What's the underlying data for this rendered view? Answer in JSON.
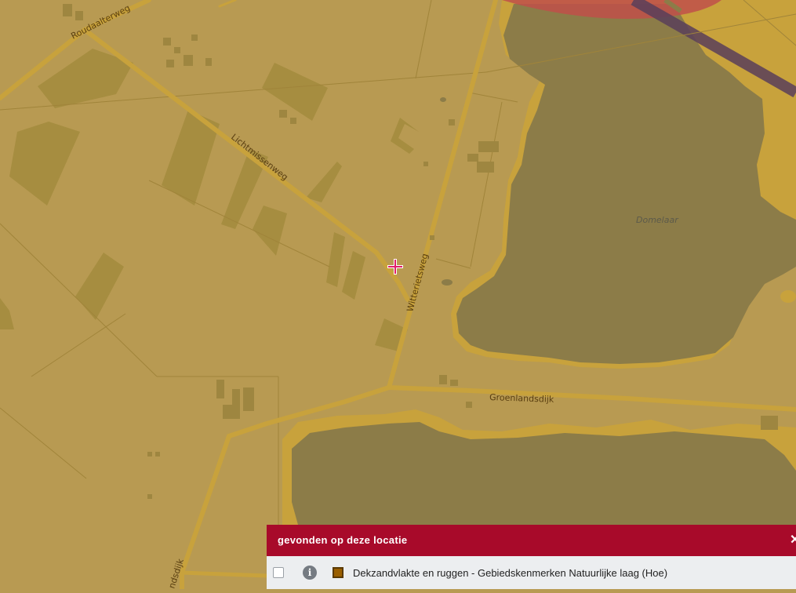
{
  "map": {
    "road_labels": {
      "roudaalterweg": "Roudaalterweg",
      "lichtmissenweg": "Lichtmissenweg",
      "witteriets": "Witterietsweg",
      "groenlandsdijk": "Groenlandsdijk",
      "landsdijk": "ndsdijk"
    },
    "place_labels": {
      "domelaar": "Domelaar"
    },
    "colors": {
      "background": "#b89a52",
      "fields": "#a58c3e",
      "water": "#8c7c48",
      "roads": "#c8a23c",
      "highlight": "#c0504a",
      "pipeline": "#5a3f5a",
      "crosshair": "#e0206a"
    },
    "crosshair_icon": "crosshair-icon"
  },
  "panel": {
    "title": "gevonden op deze locatie",
    "close_icon": "close-icon",
    "close_symbol": "✕",
    "row": {
      "info_symbol": "i",
      "swatch_color": "#9a5f00",
      "label": "Dekzandvlakte en ruggen - Gebiedskenmerken Natuurlijke laag (Hoe)"
    }
  }
}
